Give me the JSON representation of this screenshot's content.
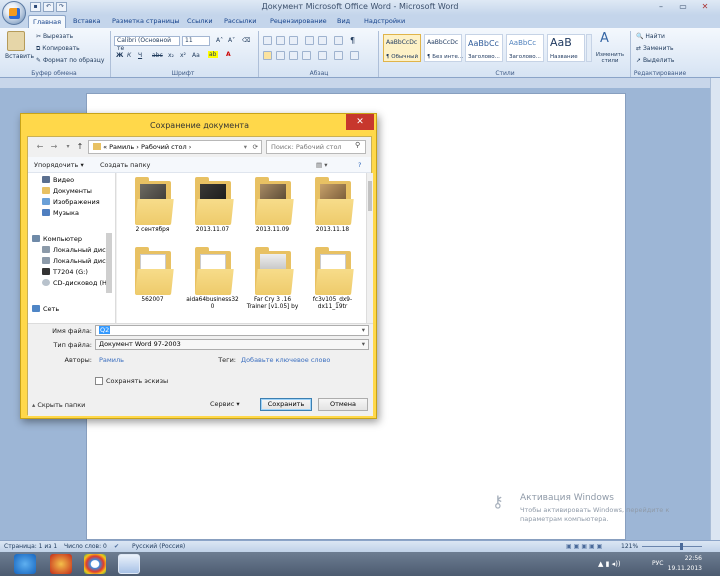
{
  "window": {
    "title": "Документ Microsoft Office Word - Microsoft Word"
  },
  "qat": {
    "undo": "↶",
    "redo": "↷",
    "save": "▪"
  },
  "tabs": [
    "Главная",
    "Вставка",
    "Разметка страницы",
    "Ссылки",
    "Рассылки",
    "Рецензирование",
    "Вид",
    "Надстройки"
  ],
  "ribbon": {
    "clipboard": {
      "paste": "Вставить",
      "cut": "Вырезать",
      "copy": "Копировать",
      "format": "Формат по образцу",
      "label": "Буфер обмена"
    },
    "font": {
      "name": "Calibri (Основной те",
      "size": "11",
      "label": "Шрифт"
    },
    "paragraph": {
      "label": "Абзац"
    },
    "styles": {
      "items": [
        {
          "preview": "AaBbCcDc",
          "name": "¶ Обычный"
        },
        {
          "preview": "AaBbCcDc",
          "name": "¶ Без инте..."
        },
        {
          "preview": "AaBbCc",
          "name": "Заголово..."
        },
        {
          "preview": "AaBbCc",
          "name": "Заголово..."
        },
        {
          "preview": "AaB",
          "name": "Название"
        }
      ],
      "change": "Изменить стили",
      "label": "Стили"
    },
    "editing": {
      "find": "Найти",
      "replace": "Заменить",
      "select": "Выделить",
      "label": "Редактирование"
    }
  },
  "dialog": {
    "title": "Сохранение документа",
    "address": [
      "«",
      "Рамиль",
      "›",
      "Рабочий стол",
      "›"
    ],
    "search_placeholder": "Поиск: Рабочий стол",
    "organize": "Упорядочить ▾",
    "new_folder": "Создать папку",
    "nav_items": [
      "Видео",
      "Документы",
      "Изображения",
      "Музыка",
      "Компьютер",
      "Локальный диск",
      "Локальный диск",
      "T7204 (G:)",
      "CD-дисковод (H",
      "Сеть"
    ],
    "files": [
      {
        "name": "2 сентября"
      },
      {
        "name": "2013.11.07"
      },
      {
        "name": "2013.11.09"
      },
      {
        "name": "2013.11.18"
      },
      {
        "name": "562007"
      },
      {
        "name": "aida64business320"
      },
      {
        "name": "Far Cry 3 .16 Trainer [v1.05] by"
      },
      {
        "name": "fc3v105_dx9-dx11_19tr"
      }
    ],
    "filename_label": "Имя файла:",
    "filename_value": "Q2",
    "filetype_label": "Тип файла:",
    "filetype_value": "Документ Word 97-2003",
    "authors_label": "Авторы:",
    "authors_value": "Рамиль",
    "tags_label": "Теги:",
    "tags_value": "Добавьте ключевое слово",
    "thumbnails_label": "Сохранять эскизы",
    "hide_folders": "Скрыть папки",
    "service": "Сервис",
    "save": "Сохранить",
    "cancel": "Отмена"
  },
  "statusbar": {
    "page": "Страница: 1 из 1",
    "words": "Число слов: 0",
    "language": "Русский (Россия)",
    "zoom": "121%"
  },
  "watermark": {
    "title": "Активация Windows",
    "line1": "Чтобы активировать Windows, перейдите к",
    "line2": "параметрам компьютера."
  },
  "tray": {
    "time": "22:56",
    "date": "19.11.2013",
    "lang": "РУС"
  }
}
